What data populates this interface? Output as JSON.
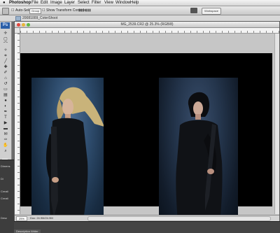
{
  "menubar": {
    "app_name": "Photoshop",
    "items": [
      "File",
      "Edit",
      "Image",
      "Layer",
      "Select",
      "Filter",
      "View",
      "Window",
      "Help"
    ]
  },
  "options_bar": {
    "auto_select_label": "Auto-Select",
    "auto_select_value": "Group",
    "show_transform_label": "Show Transform Controls",
    "workspace_label": "Workspace"
  },
  "file_bar": {
    "path": "20081009_CoterShoot"
  },
  "document": {
    "title": "MG_2539.CR2 @ 25.3% (RGB/8)",
    "zoom": "25%",
    "doc_info": "Doc: 24.9M/24.9M"
  },
  "left_panel": {
    "labels": [
      "Dimens",
      "Di",
      "Creati",
      "Creati",
      "Desc"
    ]
  },
  "bottom": {
    "tab_label": "Description Writer"
  },
  "colors": {
    "close": "#e2463c",
    "minimize": "#e8b53a",
    "zoom": "#5fb845",
    "canvas_bg": "#000000",
    "window_bg": "#c6c6c6"
  },
  "icons": {
    "tools": [
      "move-icon",
      "marquee-icon",
      "lasso-icon",
      "magic-wand-icon",
      "crop-icon",
      "slice-icon",
      "healing-icon",
      "brush-icon",
      "stamp-icon",
      "history-brush-icon",
      "eraser-icon",
      "gradient-icon",
      "blur-icon",
      "dodge-icon",
      "pen-icon",
      "type-icon",
      "path-select-icon",
      "shape-icon",
      "notes-icon",
      "eyedropper-icon",
      "hand-icon",
      "zoom-icon"
    ]
  }
}
